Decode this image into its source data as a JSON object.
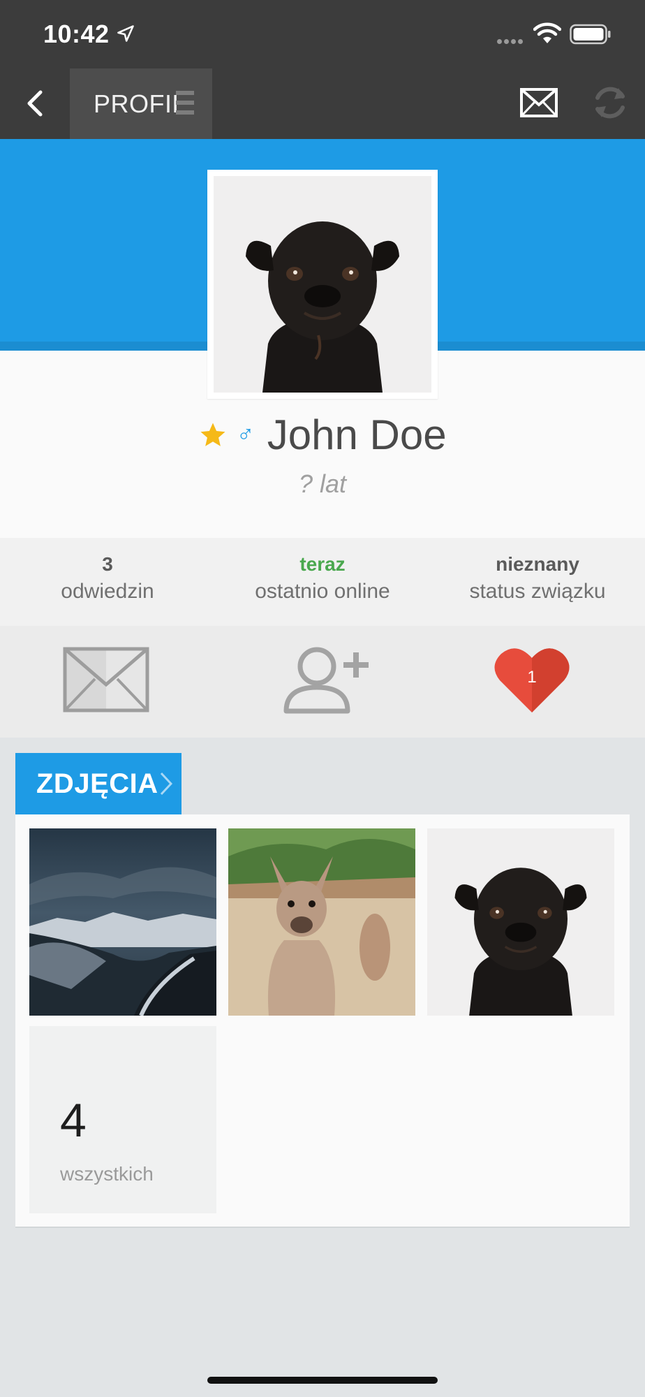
{
  "status_bar": {
    "time": "10:42"
  },
  "app_bar": {
    "tab_label": "PROFIL"
  },
  "profile": {
    "name": "John Doe",
    "age": "? lat",
    "gender_symbol": "♂"
  },
  "stats": [
    {
      "value": "3",
      "label": "odwiedzin"
    },
    {
      "value": "teraz",
      "label": "ostatnio online"
    },
    {
      "value": "nieznany",
      "label": "status związku"
    }
  ],
  "actions": {
    "likes_count": "1"
  },
  "photos": {
    "section_label": "ZDJĘCIA",
    "total_count": "4",
    "total_label": "wszystkich"
  },
  "colors": {
    "accent": "#1e9be5",
    "appbar": "#3c3c3c",
    "online": "#4aa84e",
    "heart": "#e74c3c",
    "star": "#f5b918"
  },
  "icons": [
    "location-arrow-icon",
    "wifi-icon",
    "battery-icon",
    "back-icon",
    "menu-icon",
    "mail-icon",
    "refresh-icon",
    "star-icon",
    "male-icon",
    "add-friend-icon",
    "heart-icon",
    "chevron-right-icon"
  ]
}
